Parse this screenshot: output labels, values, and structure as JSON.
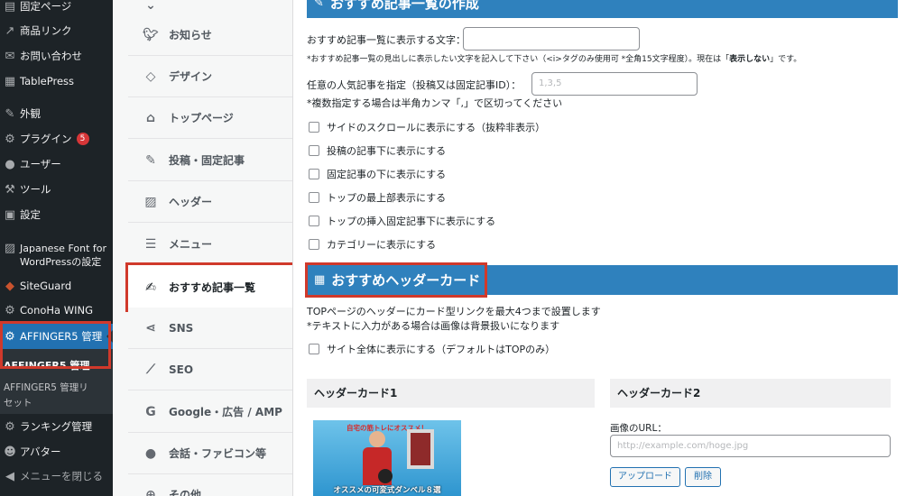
{
  "admin_menu": {
    "items": [
      {
        "label": "固定ページ",
        "icon": "page-icon"
      },
      {
        "label": "商品リンク",
        "icon": "link-icon"
      },
      {
        "label": "お問い合わせ",
        "icon": "mail-icon"
      },
      {
        "label": "TablePress",
        "icon": "table-icon"
      },
      {
        "label": "外観",
        "icon": "brush-icon"
      },
      {
        "label": "プラグイン",
        "icon": "plugin-icon",
        "badge": "5"
      },
      {
        "label": "ユーザー",
        "icon": "user-icon"
      },
      {
        "label": "ツール",
        "icon": "wrench-icon"
      },
      {
        "label": "設定",
        "icon": "settings-icon"
      },
      {
        "label": "Japanese Font for WordPressの設定",
        "icon": "font-icon"
      },
      {
        "label": "SiteGuard",
        "icon": "shield-icon"
      },
      {
        "label": "ConoHa WING",
        "icon": "gear-icon"
      },
      {
        "label": "AFFINGER5 管理",
        "icon": "gear-icon"
      },
      {
        "label": "ランキング管理",
        "icon": "gear-icon"
      },
      {
        "label": "アバター",
        "icon": "avatar-icon"
      },
      {
        "label": "メニューを閉じる",
        "icon": "collapse-icon"
      }
    ],
    "submenu_title": "AFFINGER5 管理",
    "submenu_item": "AFFINGER5 管理リセット"
  },
  "settings_nav": [
    {
      "label": "お知らせ",
      "icon": "twitter-icon"
    },
    {
      "label": "デザイン",
      "icon": "diamond-icon"
    },
    {
      "label": "トップページ",
      "icon": "home-icon"
    },
    {
      "label": "投稿・固定記事",
      "icon": "edit-icon"
    },
    {
      "label": "ヘッダー",
      "icon": "image-icon"
    },
    {
      "label": "メニュー",
      "icon": "menu-icon"
    },
    {
      "label": "おすすめ記事一覧",
      "icon": "pen-square-icon"
    },
    {
      "label": "SNS",
      "icon": "share-icon"
    },
    {
      "label": "SEO",
      "icon": "chart-icon"
    },
    {
      "label": "Google・広告 / AMP",
      "icon": "google-icon"
    },
    {
      "label": "会話・ファビコン等",
      "icon": "comment-icon"
    },
    {
      "label": "その他",
      "icon": "plus-circle-icon"
    }
  ],
  "section1": {
    "title": "おすすめ記事一覧の作成",
    "label1": "おすすめ記事一覧に表示する文字：",
    "note1_pre": "*おすすめ記事一覧の見出しに表示したい文字を記入して下さい（<i>タグのみ使用可 *全角15文字程度）。現在は「",
    "note1_bold": "表示しない",
    "note1_post": "」です。",
    "label2": "任意の人気記事を指定（投稿又は固定記事ID）：",
    "input2_placeholder": "1,3,5",
    "note2": "*複数指定する場合は半角カンマ「,」で区切ってください",
    "checkboxes": [
      "サイドのスクロールに表示にする（抜粋非表示）",
      "投稿の記事下に表示にする",
      "固定記事の下に表示にする",
      "トップの最上部表示にする",
      "トップの挿入固定記事下に表示にする",
      "カテゴリーに表示にする"
    ]
  },
  "section2": {
    "title": "おすすめヘッダーカード",
    "desc1": "TOPページのヘッダーにカード型リンクを最大4つまで設置します",
    "desc2": "*テキストに入力がある場合は画像は背景扱いになります",
    "checkbox": "サイト全体に表示にする（デフォルトはTOPのみ）",
    "card1": {
      "title": "ヘッダーカード1",
      "image_top_text": "自宅の筋トレにオススメ！",
      "image_bottom_text": "オススメの可変式ダンベル８選"
    },
    "card2": {
      "title": "ヘッダーカード2",
      "url_label": "画像のURL：",
      "url_placeholder": "http://example.com/hoge.jpg",
      "upload_label": "アップロード",
      "delete_label": "削除"
    }
  },
  "colors": {
    "admin_bg": "#1d2327",
    "accent_blue": "#2f81bd",
    "highlight_red": "#d0392b"
  }
}
